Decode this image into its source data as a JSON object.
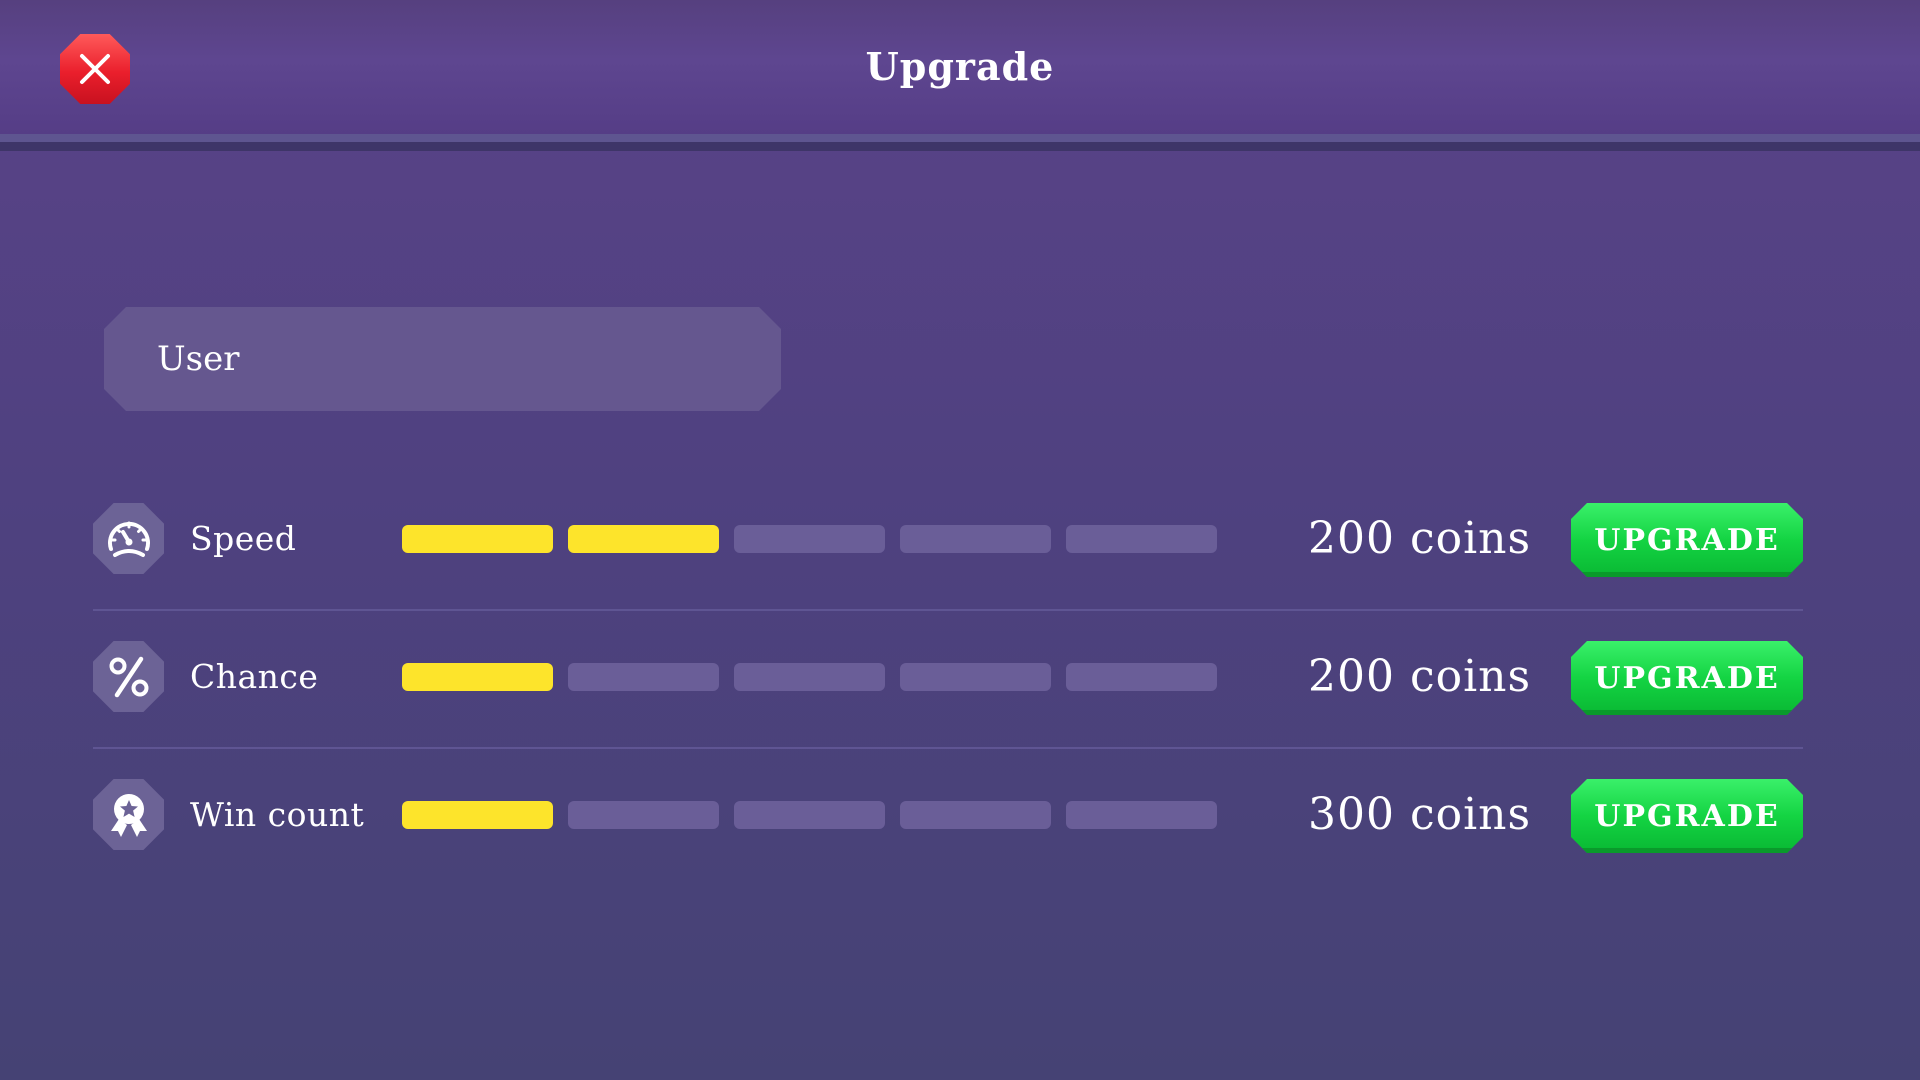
{
  "header": {
    "title": "Upgrade",
    "close_icon": "close-icon"
  },
  "user": {
    "label": "User"
  },
  "colors": {
    "background": "#4f4180",
    "bar_filled": "#fde42b",
    "bar_empty": "#6a5e98",
    "upgrade_button": "#14d443",
    "close_button": "#ea1f2c"
  },
  "upgrades": [
    {
      "icon": "speedometer-icon",
      "label": "Speed",
      "level": 2,
      "max_level": 5,
      "cost": "200 coins",
      "button_label": "UPGRADE"
    },
    {
      "icon": "percent-icon",
      "label": "Chance",
      "level": 1,
      "max_level": 5,
      "cost": "200 coins",
      "button_label": "UPGRADE"
    },
    {
      "icon": "award-ribbon-icon",
      "label": "Win count",
      "level": 1,
      "max_level": 5,
      "cost": "300 coins",
      "button_label": "UPGRADE"
    }
  ]
}
